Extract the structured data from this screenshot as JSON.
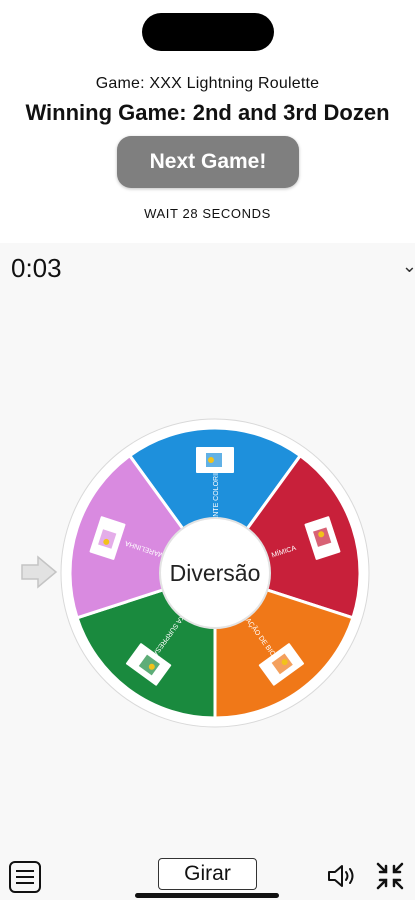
{
  "header": {
    "game_line": "Game: XXX Lightning Roulette",
    "winning_line": "Winning Game: 2nd and 3rd Dozen",
    "next_button": "Next Game!",
    "wait_text": "WAIT 28 SECONDS"
  },
  "app": {
    "timer": "0:03",
    "collapse_icon": "chevron-down-icon",
    "wheel": {
      "center_label": "Diversão",
      "segments": [
        {
          "label": "ELEFANTE COLORIDO",
          "color": "#1e90dc"
        },
        {
          "label": "MÍMICA",
          "color": "#c8203a"
        },
        {
          "label": "ADIVINHAÇÃO DE BICHOS",
          "color": "#f07818"
        },
        {
          "label": "CAIXA SURPRESA",
          "color": "#1a8a3e"
        },
        {
          "label": "AMARELINHA",
          "color": "#d98ae0"
        }
      ]
    },
    "pointer_icon": "arrow-right-icon"
  },
  "bottom": {
    "menu_icon": "menu-icon",
    "spin_button": "Girar",
    "volume_icon": "volume-icon",
    "shrink_icon": "shrink-icon"
  },
  "colors": {
    "next_button_bg": "#7f7f7f",
    "app_bg": "#f8f8f8"
  }
}
